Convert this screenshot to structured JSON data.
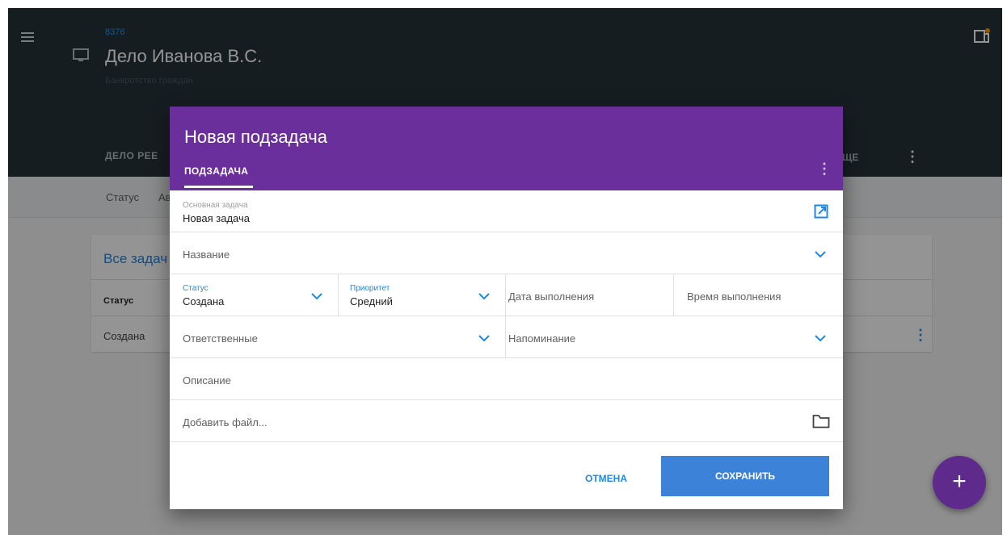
{
  "app": {
    "case_number": "8376",
    "case_title": "Дело Иванова В.С.",
    "case_subtitle": "Банкротство граждан",
    "tabs_left": "ДЕЛО   РЕЕ",
    "tab_right": "ЩЕ",
    "toolbar_status": "Статус",
    "toolbar_partial": "Ав"
  },
  "tasks_card": {
    "title": "Все задач",
    "column_status": "Статус",
    "rows": [
      {
        "status": "Создана"
      }
    ]
  },
  "fab": {
    "label": "+"
  },
  "dialog": {
    "title": "Новая подзадача",
    "tab": "ПОДЗАДАЧА",
    "main_task": {
      "label": "Основная задача",
      "value": "Новая задача"
    },
    "name_placeholder": "Название",
    "status": {
      "label": "Статус",
      "value": "Создана"
    },
    "priority": {
      "label": "Приоритет",
      "value": "Средний"
    },
    "due_date_placeholder": "Дата выполнения",
    "due_time_placeholder": "Время выполнения",
    "assignees_placeholder": "Ответственные",
    "reminder_placeholder": "Напоминание",
    "description_placeholder": "Описание",
    "add_file_placeholder": "Добавить файл...",
    "cancel_label": "ОТМЕНА",
    "save_label": "СОХРАНИТЬ"
  },
  "colors": {
    "appbar": "#263238",
    "dialog_header": "#6a2f9a",
    "accent_blue": "#1e88e5",
    "save_button": "#3b82d8",
    "fab": "#5e2a8c"
  },
  "icons": [
    "menu-icon",
    "monitor-icon",
    "notification-icon",
    "open-external-icon",
    "chevron-down-icon",
    "folder-icon",
    "kebab-menu-icon",
    "plus-icon"
  ]
}
